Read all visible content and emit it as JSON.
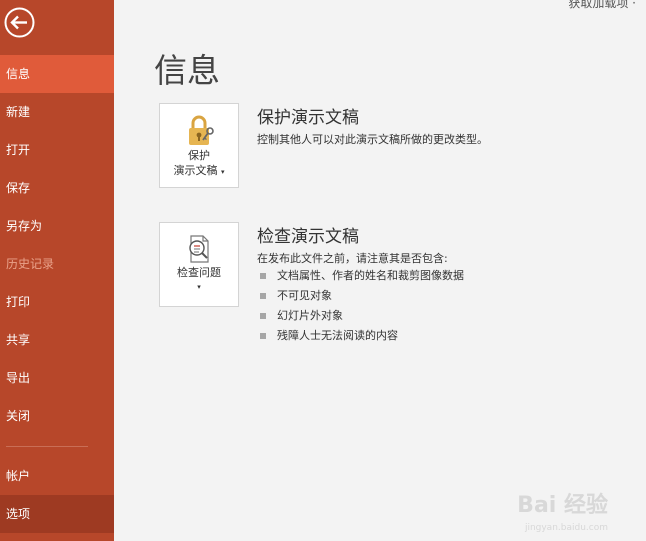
{
  "window": {
    "top_fragment": "获取加载项 ·"
  },
  "sidebar": {
    "items": [
      {
        "label": "信息"
      },
      {
        "label": "新建"
      },
      {
        "label": "打开"
      },
      {
        "label": "保存"
      },
      {
        "label": "另存为"
      },
      {
        "label": "历史记录"
      },
      {
        "label": "打印"
      },
      {
        "label": "共享"
      },
      {
        "label": "导出"
      },
      {
        "label": "关闭"
      }
    ],
    "bottom_items": [
      {
        "label": "帐户"
      },
      {
        "label": "选项"
      }
    ]
  },
  "main": {
    "title": "信息",
    "protect": {
      "tile_label_1": "保护",
      "tile_label_2": "演示文稿",
      "tile_arrow": "▾",
      "title": "保护演示文稿",
      "desc": "控制其他人可以对此演示文稿所做的更改类型。"
    },
    "inspect": {
      "tile_label": "检查问题",
      "tile_arrow": "▾",
      "title": "检查演示文稿",
      "desc": "在发布此文件之前，请注意其是否包含:",
      "bullets": [
        "文档属性、作者的姓名和裁剪图像数据",
        "不可见对象",
        "幻灯片外对象",
        "残障人士无法阅读的内容"
      ]
    }
  },
  "watermark": {
    "logo": "Bai 经验",
    "url": "jingyan.baidu.com"
  },
  "colors": {
    "sidebar": "#b7472a",
    "active": "#e05b3a",
    "hover": "#9e3a22",
    "background": "#f3f3f3"
  }
}
